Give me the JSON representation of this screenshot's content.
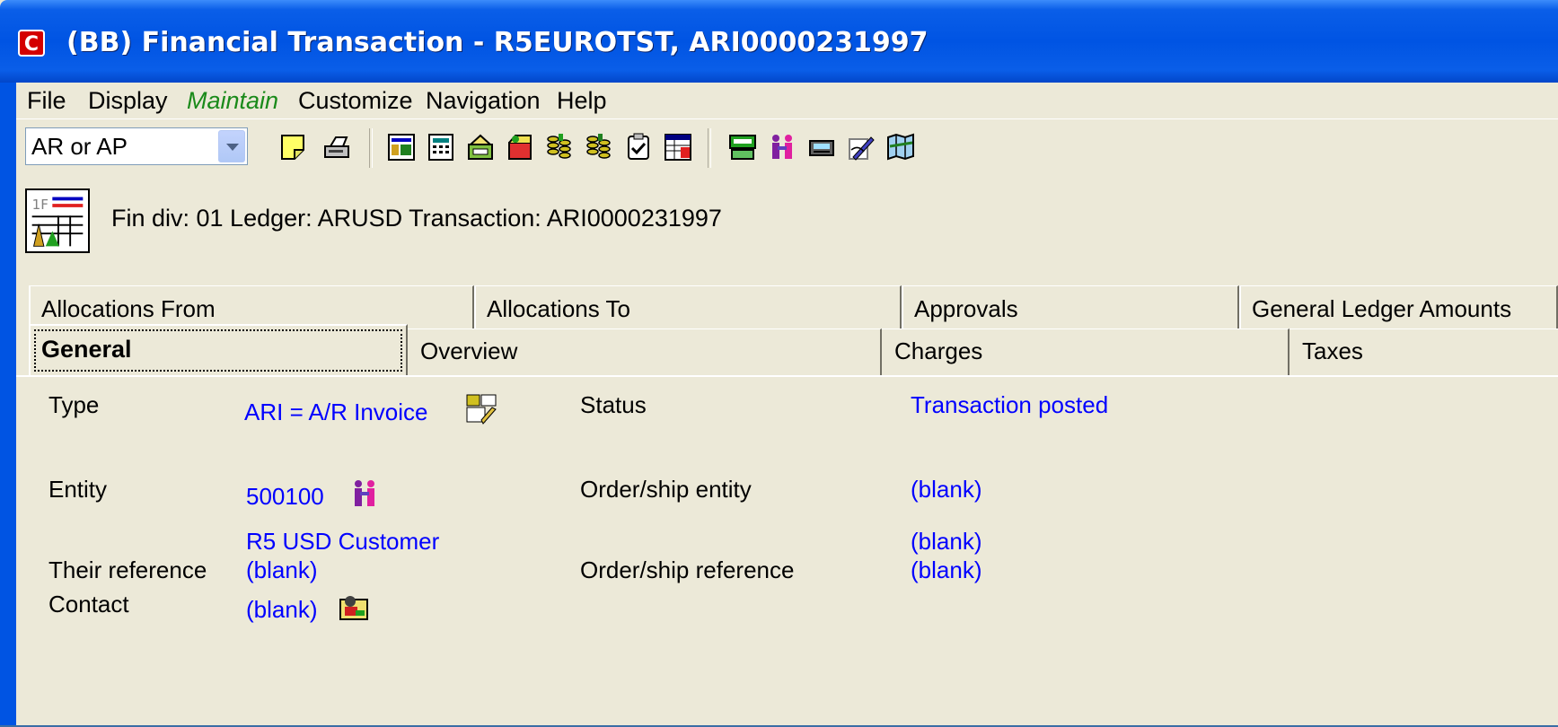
{
  "window": {
    "title": "(BB) Financial Transaction - R5EUROTST, ARI0000231997",
    "app_icon": "app-logo-icon"
  },
  "menu": {
    "file": "File",
    "display": "Display",
    "maintain": "Maintain",
    "customize": "Customize",
    "navigation": "Navigation",
    "help": "Help"
  },
  "toolbar": {
    "combo_value": "AR or AP",
    "icons": [
      "note-icon",
      "print-icon",
      "report-icon",
      "calculator-icon",
      "cash-register-icon",
      "box-icon",
      "coins-icon",
      "coins-alt-icon",
      "checklist-icon",
      "spreadsheet-icon",
      "terminal-icon",
      "people-icon",
      "card-reader-icon",
      "pen-icon",
      "map-icon"
    ]
  },
  "header": {
    "text": "Fin div: 01   Ledger: ARUSD   Transaction: ARI0000231997"
  },
  "tabs": {
    "back_row": [
      "Allocations From",
      "Allocations To",
      "Approvals",
      "General Ledger Amounts"
    ],
    "front_row": [
      "General",
      "Overview",
      "Charges",
      "Taxes"
    ]
  },
  "fields": {
    "type_label": "Type",
    "type_value": "ARI = A/R Invoice",
    "status_label": "Status",
    "status_value": "Transaction posted",
    "entity_label": "Entity",
    "entity_value": "500100",
    "entity_name": "R5 USD Customer",
    "order_ship_entity_label": "Order/ship entity",
    "order_ship_entity_value": "(blank)",
    "order_ship_entity_name": "(blank)",
    "their_reference_label": "Their reference",
    "their_reference_value": "(blank)",
    "order_ship_reference_label": "Order/ship reference",
    "order_ship_reference_value": "(blank)",
    "contact_label": "Contact",
    "contact_value": "(blank)"
  },
  "colors": {
    "titlebar": "#0054e3",
    "window_bg": "#ece9d8",
    "link_blue": "#0000ff",
    "maintain_green": "#1a8a1a"
  }
}
